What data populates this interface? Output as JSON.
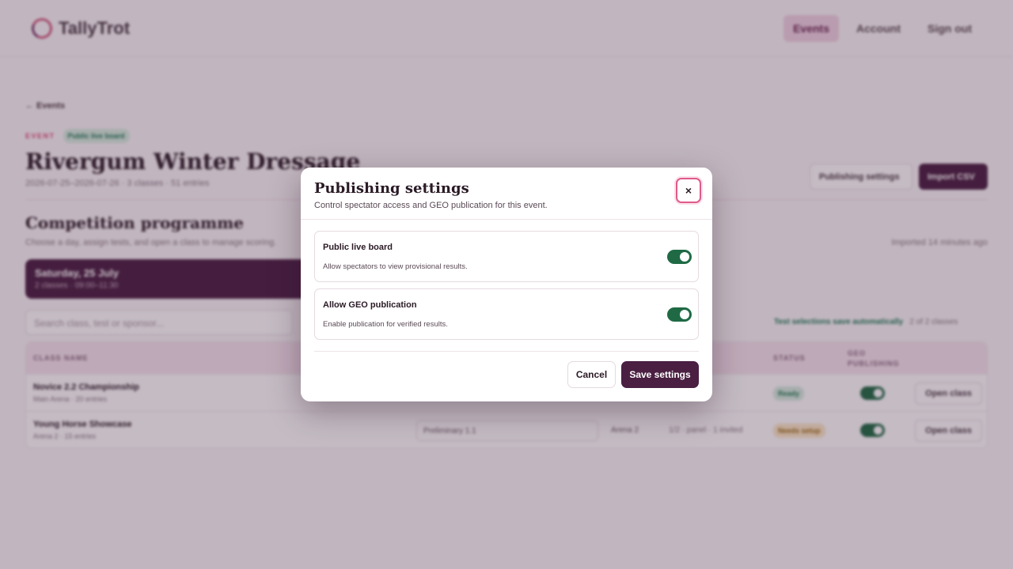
{
  "app": {
    "name": "TallyTrot",
    "nav": [
      {
        "label": "Events",
        "active": true
      },
      {
        "label": "Account",
        "active": false
      },
      {
        "label": "Sign out",
        "active": false
      }
    ]
  },
  "page": {
    "back_link": "← Events",
    "eyebrow": "EVENT",
    "live_badge": "Public live board",
    "title": "Rivergum Winter Dressage",
    "meta": "2026-07-25–2026-07-26 · 3 classes · 51 entries",
    "actions": {
      "publishing": "Publishing settings",
      "import": "Import CSV"
    },
    "section_title": "Competition programme",
    "section_sub": "Choose a day, assign tests, and open a class to manage scoring.",
    "imported": "Imported 14 minutes ago",
    "day": {
      "title": "Saturday, 25 July",
      "sub": "2 classes · 09:00–11:30"
    },
    "search_placeholder": "Search class, test or sponsor...",
    "autosave": "Test selections save automatically",
    "count": "2 of 2 classes",
    "table": {
      "headers": {
        "class": "CLASS NAME",
        "status": "STATUS",
        "geo1": "GEO",
        "geo2": "PUBLISHING"
      },
      "rows": [
        {
          "name": "Novice 2.2 Championship",
          "sub": "Main Arena · 20 entries",
          "test": "",
          "arena": "",
          "panel": "",
          "status": "Ready",
          "action": "Open class"
        },
        {
          "name": "Young Horse Showcase",
          "sub": "Arena 2 · 15 entries",
          "test": "Preliminary 1.1",
          "arena": "Arena 2",
          "panel": "1/2 · panel · 1 invited",
          "status": "Needs setup",
          "action": "Open class"
        }
      ]
    }
  },
  "modal": {
    "title": "Publishing settings",
    "subtitle": "Control spectator access and GEO publication for this event.",
    "close_glyph": "×",
    "settings": [
      {
        "title": "Public live board",
        "desc": "Allow spectators to view provisional results.",
        "enabled": true
      },
      {
        "title": "Allow GEO publication",
        "desc": "Enable publication for verified results.",
        "enabled": true
      }
    ],
    "cancel": "Cancel",
    "save": "Save settings"
  },
  "colors": {
    "brand": "#4a1f42",
    "accent": "#e05a8a",
    "toggle_on": "#1f6a45"
  }
}
